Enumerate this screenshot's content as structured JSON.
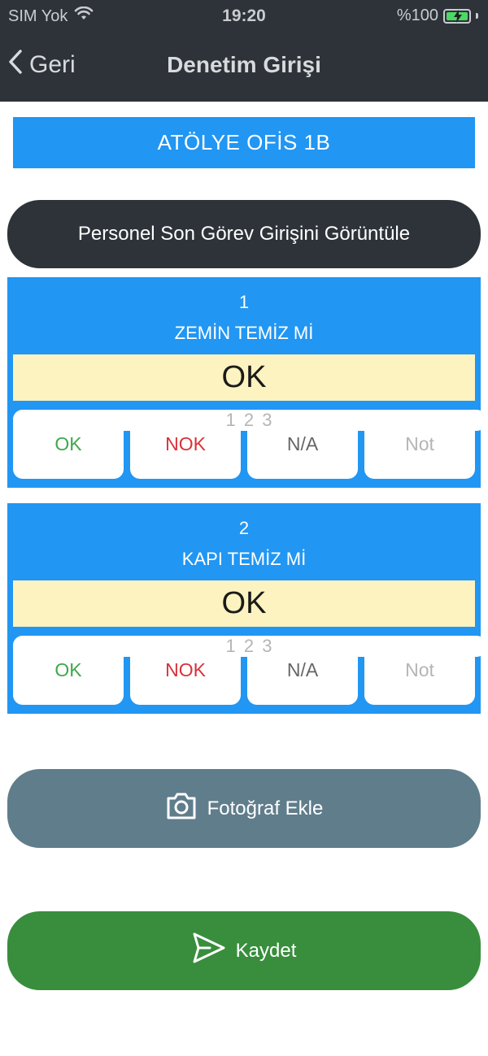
{
  "status_bar": {
    "carrier": "SIM Yok",
    "time": "19:20",
    "battery": "%100"
  },
  "nav": {
    "back_label": "Geri",
    "title": "Denetim Girişi"
  },
  "location_label": "ATÖLYE OFİS 1B",
  "view_last_entry_label": "Personel Son Görev Girişini Görüntüle",
  "questions": [
    {
      "number": "1",
      "text": "ZEMİN TEMİZ Mİ",
      "answer": "OK",
      "options": {
        "ok": "OK",
        "nok": "NOK",
        "na": "N/A",
        "numeric": "1 2 3",
        "note": "Not"
      }
    },
    {
      "number": "2",
      "text": "KAPI TEMİZ Mİ",
      "answer": "OK",
      "options": {
        "ok": "OK",
        "nok": "NOK",
        "na": "N/A",
        "numeric": "1 2 3",
        "note": "Not"
      }
    }
  ],
  "photo_button_label": "Fotoğraf Ekle",
  "save_button_label": "Kaydet",
  "colors": {
    "header_bg": "#2d3339",
    "primary_blue": "#2196f3",
    "answer_bg": "#fcf3c0",
    "ok_green": "#3fa84a",
    "nok_red": "#d8323a",
    "photo_button": "#607d8b",
    "save_button": "#388e3c"
  },
  "icons": {
    "back": "chevron-left-icon",
    "wifi": "wifi-icon",
    "battery": "battery-charging-icon",
    "camera": "camera-icon",
    "send": "send-icon"
  }
}
